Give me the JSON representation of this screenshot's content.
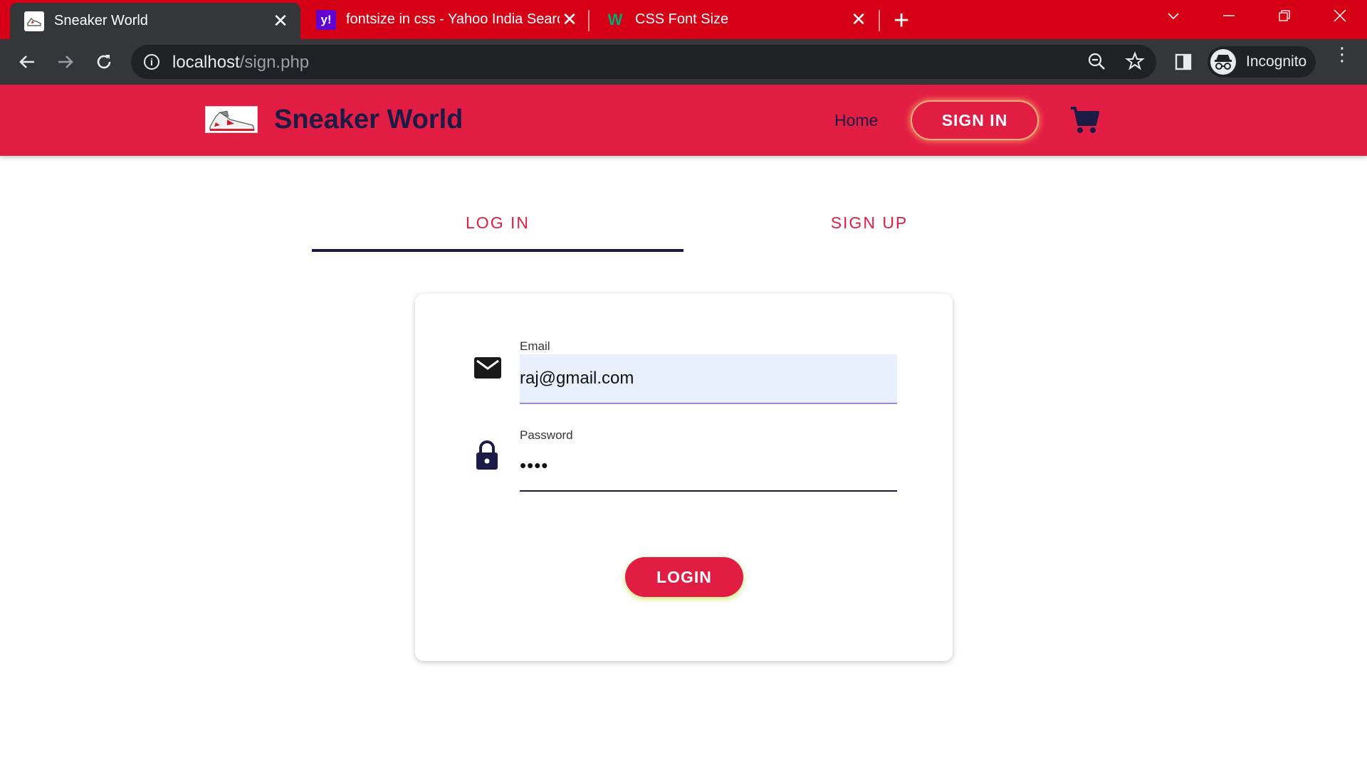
{
  "browser": {
    "tabs": [
      {
        "title": "Sneaker World",
        "favicon": "sneaker-logo",
        "active": true
      },
      {
        "title": "fontsize in css - Yahoo India Search",
        "favicon": "yahoo-logo",
        "favicon_text": "y!",
        "favicon_color": "#6001d2"
      },
      {
        "title": "CSS Font Size",
        "favicon": "w3-logo",
        "favicon_text": "W",
        "favicon_color": "#04aa6d"
      }
    ],
    "new_tab_icon": "plus-icon",
    "url_host": "localhost",
    "url_path": "/sign.php",
    "profile_label": "Incognito",
    "tab_strip_color": "#d60016",
    "toolbar_color": "#35363a"
  },
  "site": {
    "brand": "Sneaker World",
    "nav": {
      "home": "Home",
      "sign_in": "SIGN IN"
    },
    "cart_icon": "shopping-cart-icon",
    "header_color": "#e21d43",
    "accent_dark": "#1c1b45"
  },
  "auth_tabs": {
    "login": "LOG IN",
    "signup": "SIGN UP",
    "active": "login"
  },
  "form": {
    "email_label": "Email",
    "email_value": "raj@gmail.com",
    "email_icon": "mail-icon",
    "password_label": "Password",
    "password_value": "••••",
    "password_icon": "lock-icon",
    "submit_label": "LOGIN"
  }
}
